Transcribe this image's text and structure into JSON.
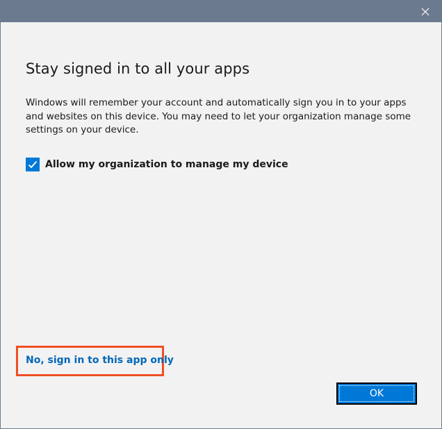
{
  "dialog": {
    "heading": "Stay signed in to all your apps",
    "description": "Windows will remember your account and automatically sign you in to your apps and websites on this device. You may need to let your organization manage some settings on your device.",
    "checkbox": {
      "label": "Allow my organization to manage my device",
      "checked": true
    },
    "link_label": "No, sign in to this app only",
    "ok_label": "OK"
  },
  "icons": {
    "close": "close-icon",
    "check": "checkmark-icon"
  },
  "colors": {
    "titlebar": "#6b7a8f",
    "background": "#f2f2f2",
    "accent": "#0078d7",
    "link": "#0067b8",
    "highlight": "#ef4f23"
  }
}
